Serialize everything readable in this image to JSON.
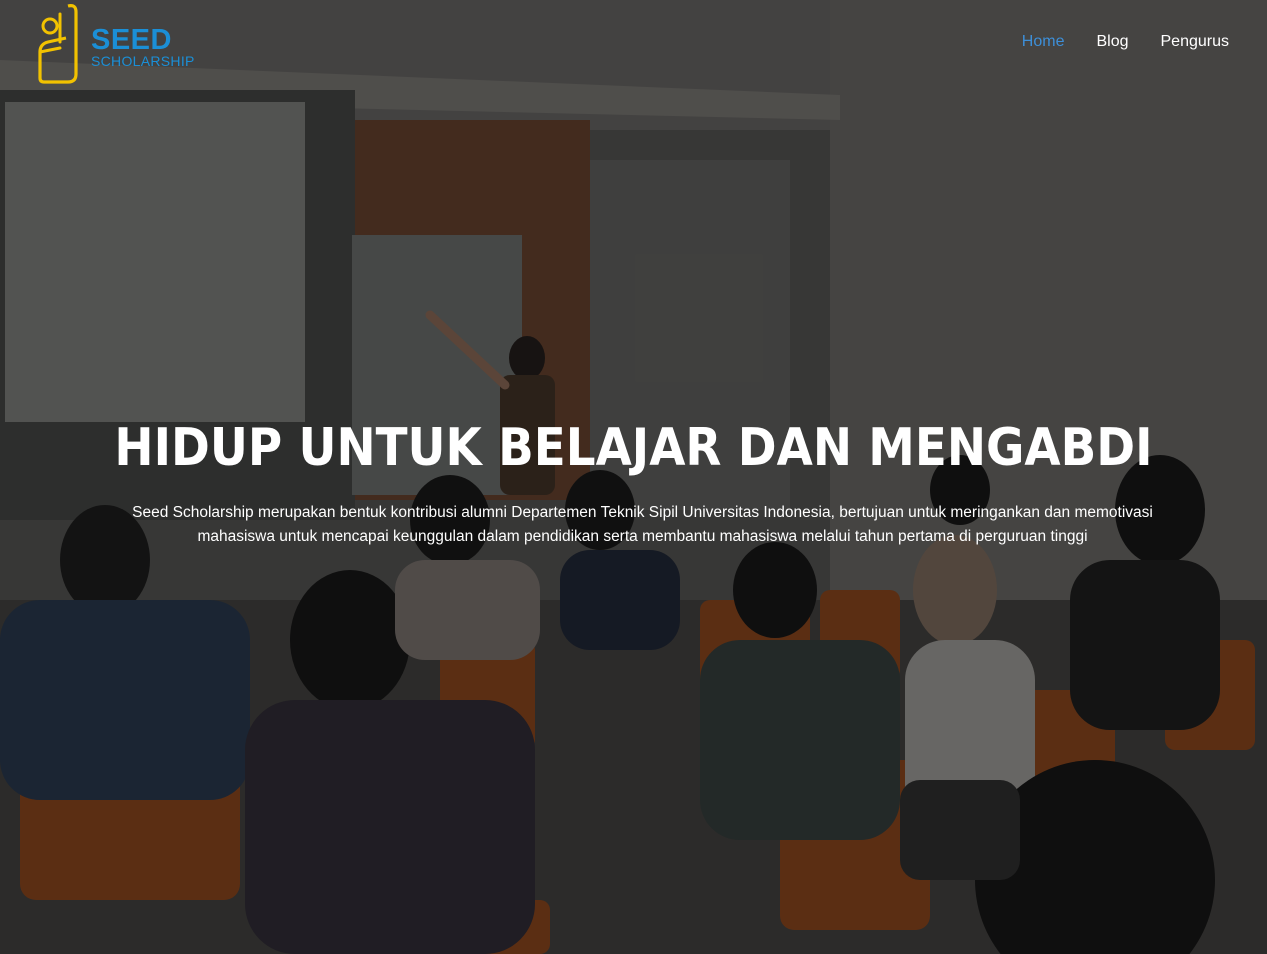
{
  "brand": {
    "line1": "SEED",
    "line2": "SCHOLARSHIP",
    "primary_color": "#1b8fd6",
    "mark_color": "#f2c200",
    "logo_icon": "seed-logo-icon"
  },
  "nav": {
    "items": [
      {
        "label": "Home",
        "active": true
      },
      {
        "label": "Blog",
        "active": false
      },
      {
        "label": "Pengurus",
        "active": false
      }
    ],
    "active_color": "#3d8fd8",
    "text_color": "#ffffff"
  },
  "hero": {
    "title": "HIDUP UNTUK BELAJAR DAN MENGABDI",
    "description": "Seed Scholarship merupakan bentuk kontribusi alumni Departemen Teknik Sipil Universitas Indonesia, bertujuan untuk meringankan dan memotivasi mahasiswa untuk mencapai keunggulan dalam pendidikan serta membantu mahasiswa melalui tahun pertama di perguruan tinggi",
    "background": "classroom-photo"
  }
}
